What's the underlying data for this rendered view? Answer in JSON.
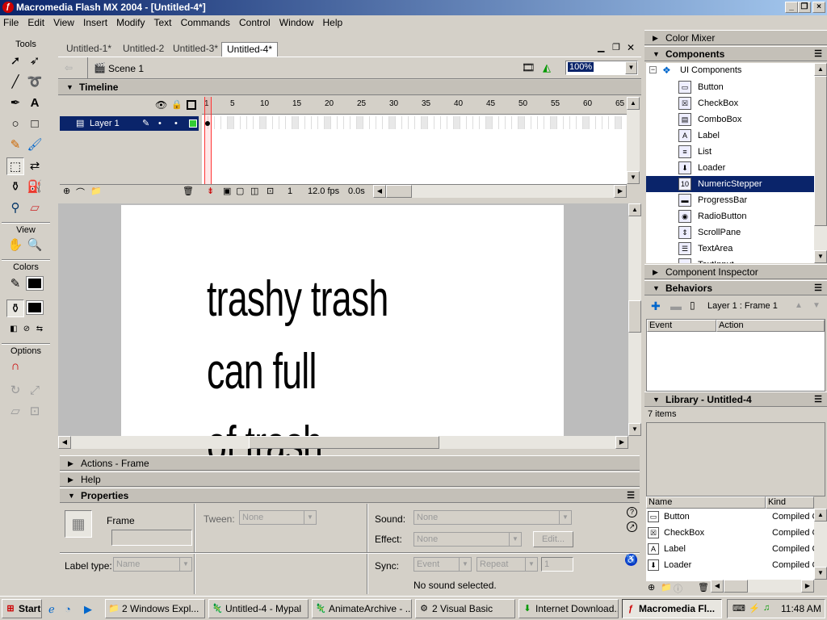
{
  "window": {
    "title": "Macromedia Flash MX 2004 - [Untitled-4*]"
  },
  "menu": [
    "File",
    "Edit",
    "View",
    "Insert",
    "Modify",
    "Text",
    "Commands",
    "Control",
    "Window",
    "Help"
  ],
  "tools_panel": {
    "title": "Tools",
    "view_label": "View",
    "colors_label": "Colors",
    "options_label": "Options"
  },
  "doc_tabs": [
    "Untitled-1*",
    "Untitled-2",
    "Untitled-3*",
    "Untitled-4*"
  ],
  "scene": {
    "label": "Scene 1",
    "zoom": "100%"
  },
  "timeline": {
    "title": "Timeline",
    "layer": "Layer 1",
    "ruler": [
      "1",
      "5",
      "10",
      "15",
      "20",
      "25",
      "30",
      "35",
      "40",
      "45",
      "50",
      "55",
      "60",
      "65"
    ],
    "current_frame": "1",
    "fps": "12.0 fps",
    "elapsed": "0.0s"
  },
  "stage": {
    "text_line1": "trashy trash can full",
    "text_line2": "of trash"
  },
  "panels": {
    "actions": "Actions - Frame",
    "help": "Help",
    "properties": "Properties"
  },
  "properties": {
    "frame_label": "Frame",
    "tween_label": "Tween:",
    "tween_value": "None",
    "sound_label": "Sound:",
    "sound_value": "None",
    "effect_label": "Effect:",
    "effect_value": "None",
    "edit_button": "Edit...",
    "label_type_label": "Label type:",
    "label_type_value": "Name",
    "sync_label": "Sync:",
    "sync_value": "Event",
    "repeat_value": "Repeat",
    "repeat_count": "1",
    "no_sound": "No sound selected."
  },
  "right": {
    "color_mixer": "Color Mixer",
    "components": "Components",
    "ui_components": "UI Components",
    "component_items": [
      "Button",
      "CheckBox",
      "ComboBox",
      "Label",
      "List",
      "Loader",
      "NumericStepper",
      "ProgressBar",
      "RadioButton",
      "ScrollPane",
      "TextArea",
      "TextInput"
    ],
    "selected_component": "NumericStepper",
    "component_inspector": "Component Inspector",
    "behaviors": "Behaviors",
    "behaviors_context": "Layer 1 : Frame 1",
    "event_col": "Event",
    "action_col": "Action",
    "library": "Library - Untitled-4",
    "library_count": "7 items",
    "lib_name_col": "Name",
    "lib_kind_col": "Kind",
    "library_items": [
      {
        "name": "Button",
        "kind": "Compiled C"
      },
      {
        "name": "CheckBox",
        "kind": "Compiled C"
      },
      {
        "name": "Label",
        "kind": "Compiled C"
      },
      {
        "name": "Loader",
        "kind": "Compiled C"
      }
    ]
  },
  "taskbar": {
    "start": "Start",
    "buttons": [
      "2 Windows Expl...",
      "Untitled-4 - Mypal",
      "AnimateArchive - ...",
      "2 Visual Basic",
      "Internet Download...",
      "Macromedia Fl..."
    ],
    "clock": "11:48 AM"
  }
}
